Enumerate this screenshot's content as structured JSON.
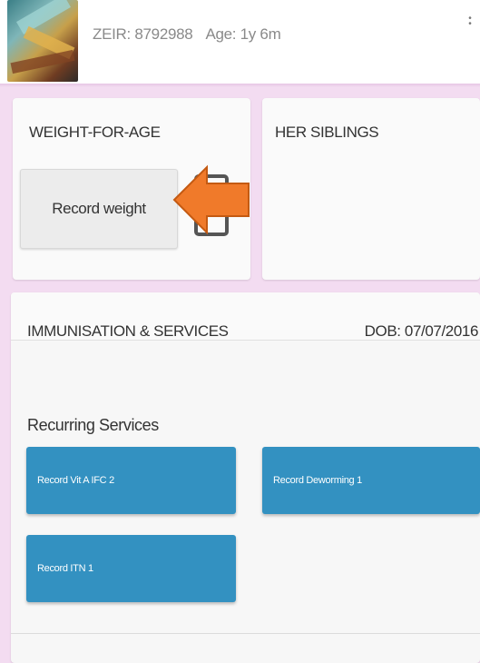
{
  "header": {
    "zeir": "ZEIR: 8792988",
    "age": "Age: 1y 6m"
  },
  "weight_card": {
    "title": "WEIGHT-FOR-AGE",
    "record_button": "Record weight"
  },
  "siblings_card": {
    "title": "HER SIBLINGS"
  },
  "immunisation": {
    "title": "IMMUNISATION & SERVICES",
    "dob": "DOB: 07/07/2016",
    "recurring_title": "Recurring Services",
    "services": [
      "Record Vit A IFC 2",
      "Record Deworming 1",
      "Record ITN 1"
    ]
  },
  "colors": {
    "accent_blue": "#3391c1",
    "background_pink": "#f3dcf1",
    "arrow_orange": "#f07a2a"
  },
  "icons": [
    "menu-dots-icon",
    "document-icon",
    "orange-arrow-icon"
  ]
}
